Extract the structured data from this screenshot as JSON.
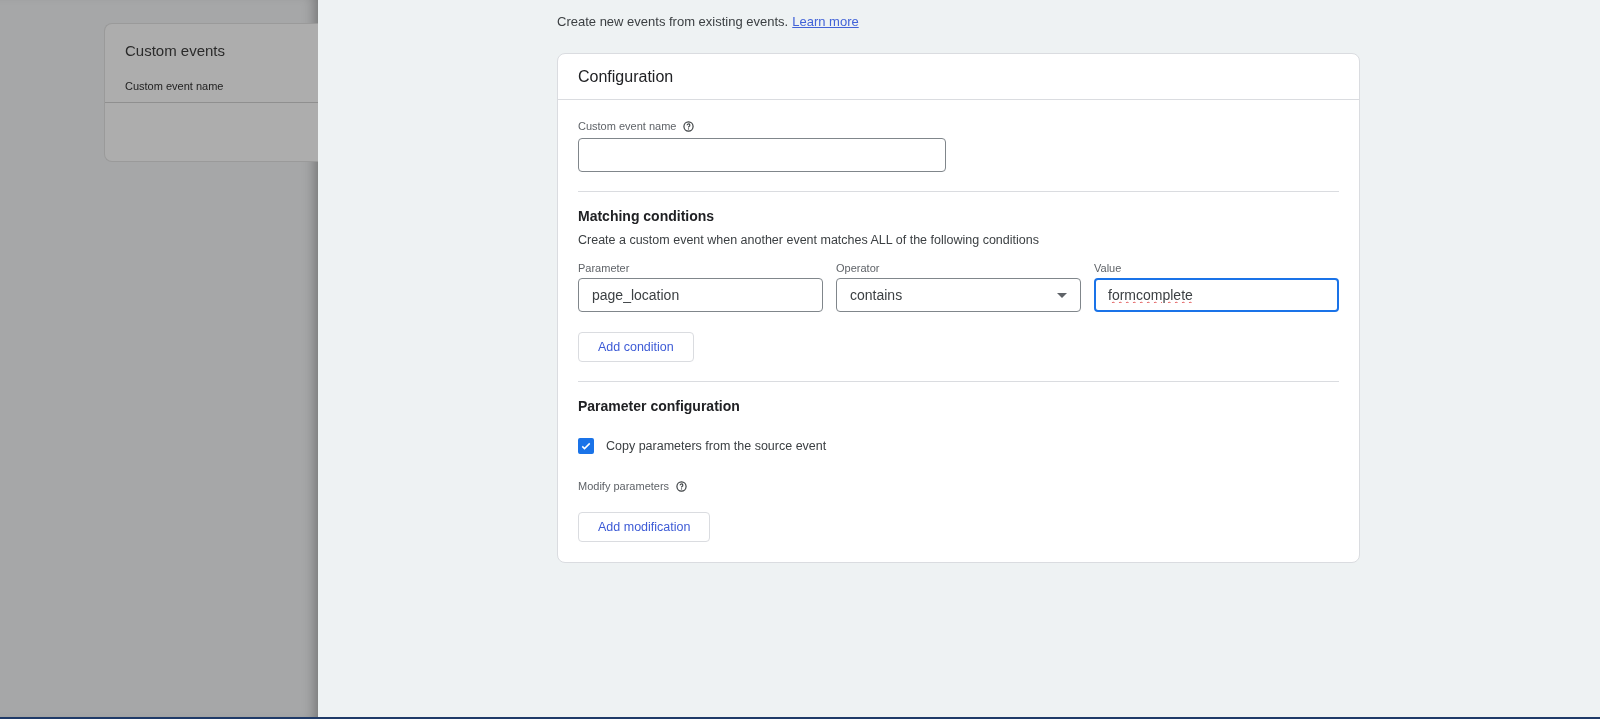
{
  "background_card": {
    "title": "Custom events",
    "column_header": "Custom event name"
  },
  "intro": {
    "text": "Create new events from existing events.",
    "link": "Learn more"
  },
  "configuration": {
    "title": "Configuration",
    "custom_event_name": {
      "label": "Custom event name"
    },
    "matching_conditions": {
      "title": "Matching conditions",
      "description": "Create a custom event when another event matches ALL of the following conditions",
      "fields": [
        {
          "label": "Parameter",
          "kind": "text",
          "value": "page_location",
          "focused": false
        },
        {
          "label": "Operator",
          "kind": "dropdown",
          "value": "contains",
          "focused": false
        },
        {
          "label": "Value",
          "kind": "text",
          "value": "formcomplete",
          "focused": true
        }
      ],
      "add_button": "Add condition"
    },
    "parameter_configuration": {
      "title": "Parameter configuration",
      "copy_checkbox": {
        "label": "Copy parameters from the source event",
        "checked": true
      },
      "modify_label": "Modify parameters",
      "add_button": "Add modification"
    }
  }
}
